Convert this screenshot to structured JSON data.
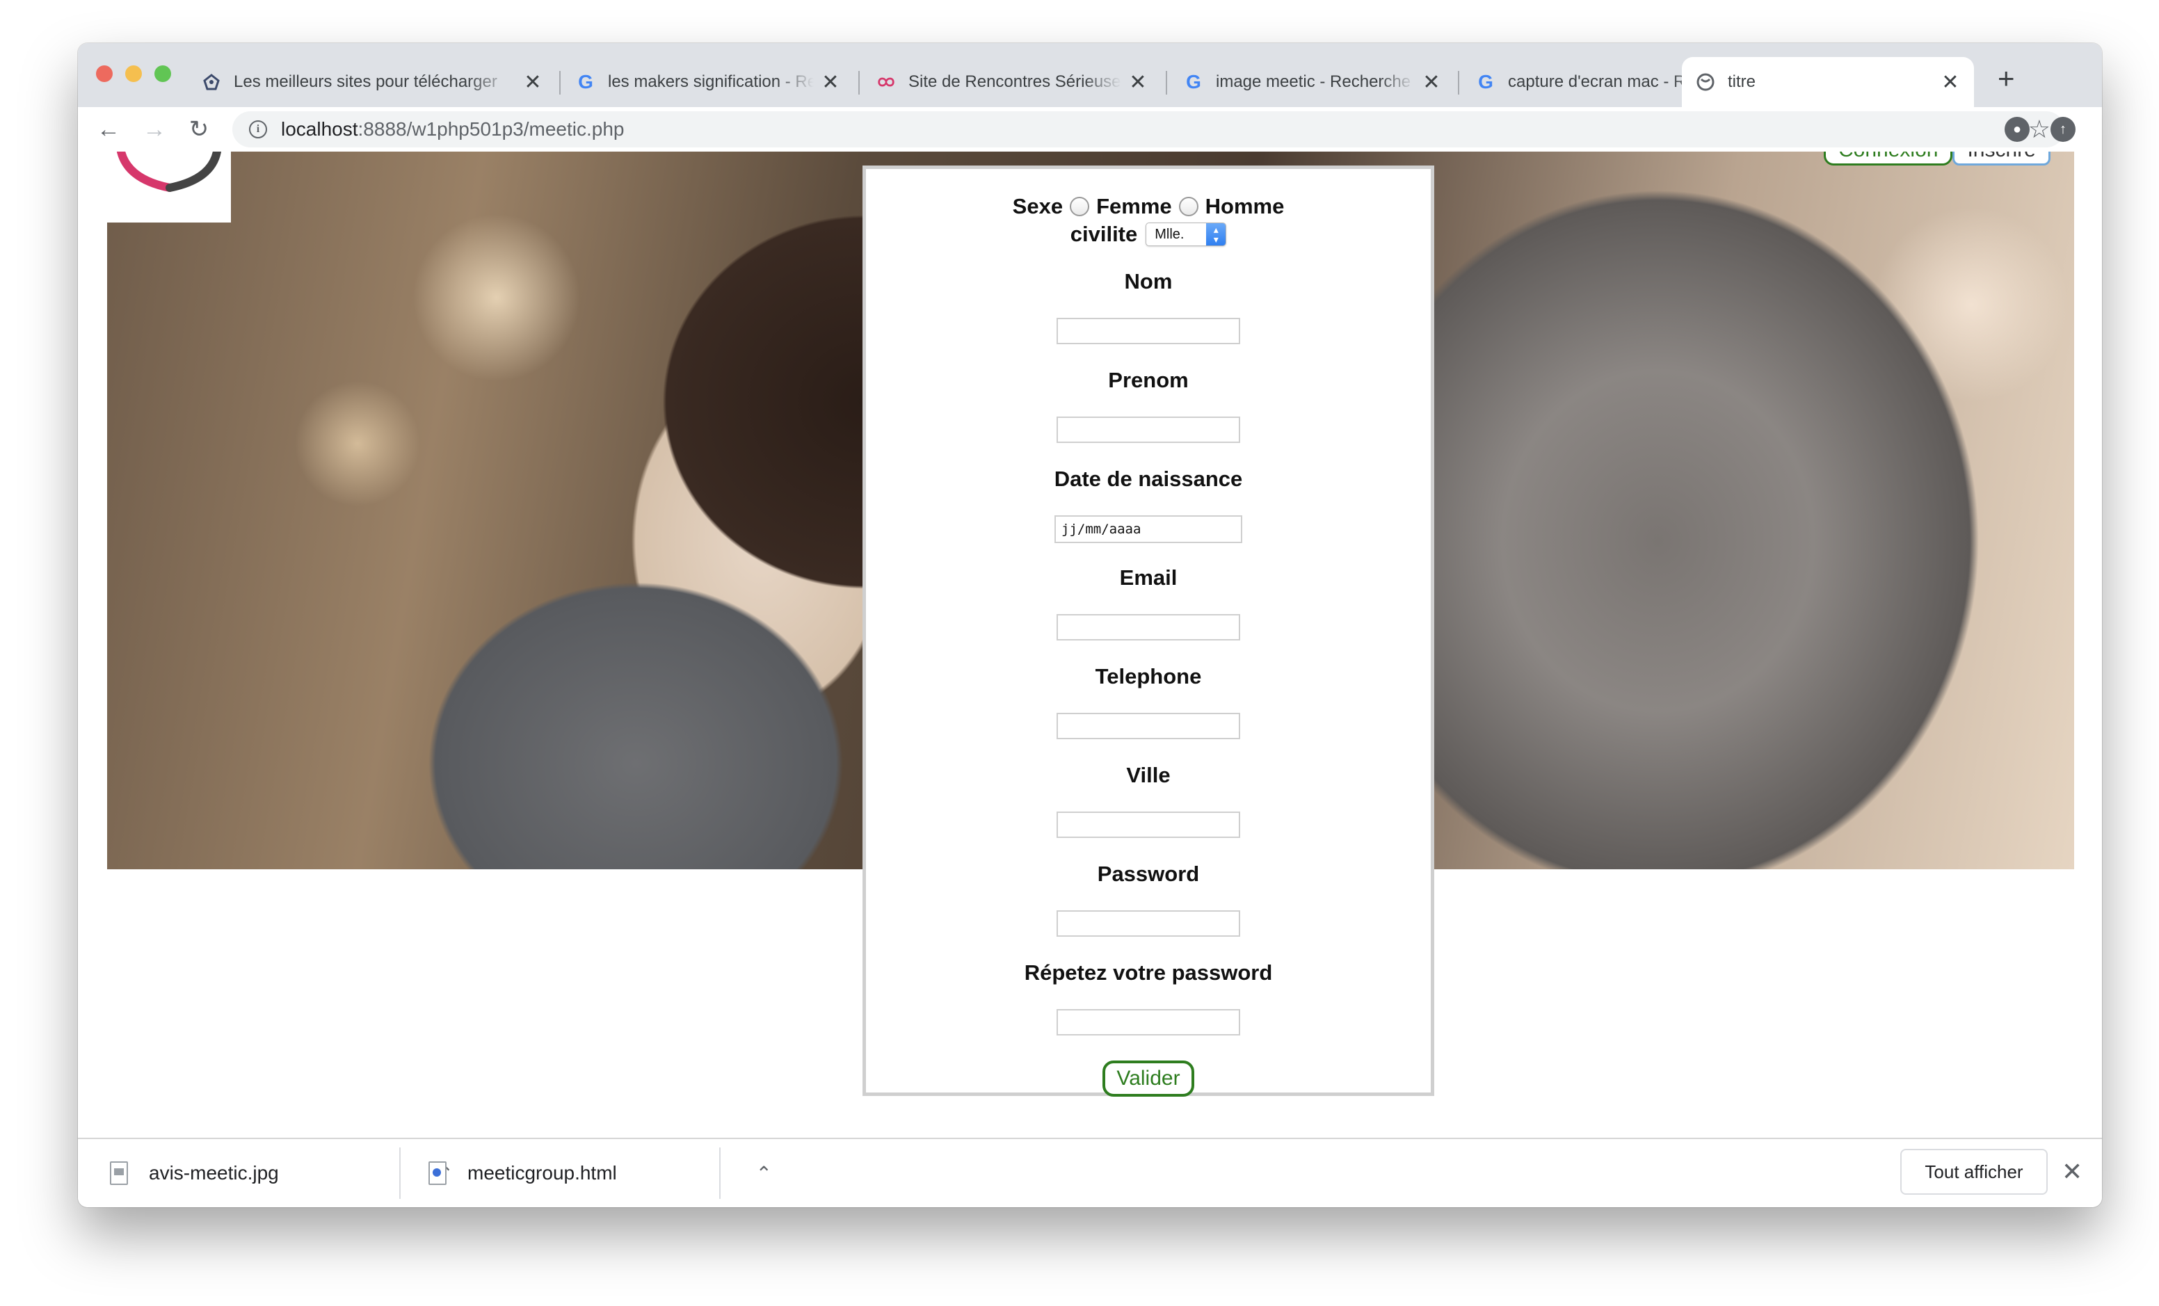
{
  "browser": {
    "tabs": [
      {
        "title": "Les meilleurs sites pour télécharger",
        "favicon": "meetic-icon",
        "active": false
      },
      {
        "title": "les makers signification - Recherche",
        "favicon": "google-g",
        "active": false
      },
      {
        "title": "Site de Rencontres Sérieuses",
        "favicon": "meetic-icon",
        "active": false
      },
      {
        "title": "image meetic - Recherche Google",
        "favicon": "google-g",
        "active": false
      },
      {
        "title": "capture d'ecran mac - Recherche",
        "favicon": "google-g",
        "active": false
      },
      {
        "title": "titre",
        "favicon": "globe-icon",
        "active": true
      }
    ],
    "url_host": "localhost",
    "url_rest": ":8888/w1php501p3/meetic.php"
  },
  "page": {
    "top_buttons": [
      "Connexion",
      "Inscrire"
    ],
    "form": {
      "sexe_label": "Sexe",
      "option_femme": "Femme",
      "option_homme": "Homme",
      "civilite_label": "civilite",
      "civilite_value": "Mlle.",
      "fields": [
        {
          "label": "Nom",
          "value": ""
        },
        {
          "label": "Prenom",
          "value": ""
        },
        {
          "label": "Date de naissance",
          "value": "jj/mm/aaaa"
        },
        {
          "label": "Email",
          "value": ""
        },
        {
          "label": "Telephone",
          "value": ""
        },
        {
          "label": "Ville",
          "value": ""
        },
        {
          "label": "Password",
          "value": ""
        },
        {
          "label": "Répetez votre password",
          "value": ""
        }
      ],
      "submit_label": "Valider"
    }
  },
  "downloads": {
    "items": [
      {
        "name": "avis-meetic.jpg"
      },
      {
        "name": "meeticgroup.html"
      }
    ],
    "show_all": "Tout afficher"
  },
  "colors": {
    "button_green": "#2e7d1f",
    "tabbar": "#dee1e6",
    "form_border": "#cfcfcf"
  }
}
